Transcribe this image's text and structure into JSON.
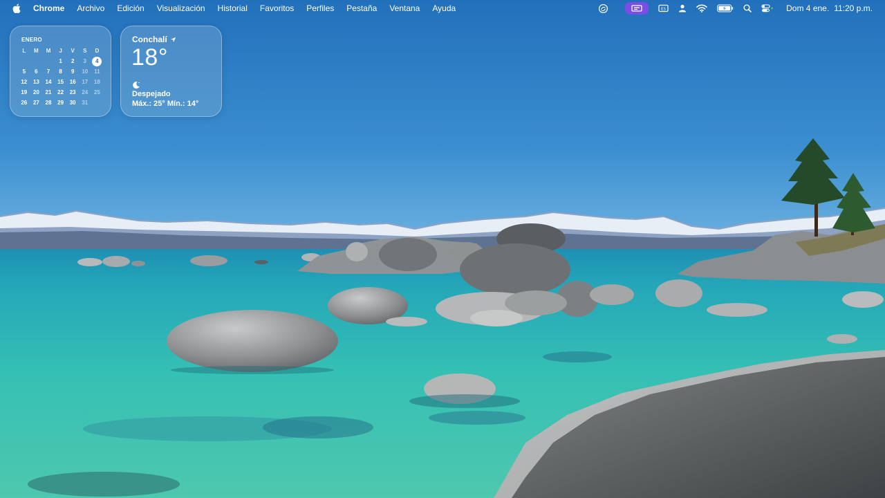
{
  "menubar": {
    "app_name": "Chrome",
    "menus": [
      "Archivo",
      "Edición",
      "Visualización",
      "Historial",
      "Favoritos",
      "Perfiles",
      "Pestaña",
      "Ventana",
      "Ayuda"
    ],
    "icons": [
      "apple-icon",
      "chatgpt-icon",
      "screen-share-icon",
      "input-menu-icon",
      "user-icon",
      "wifi-icon",
      "battery-icon",
      "search-icon",
      "control-center-icon"
    ],
    "accent_pill_color": "#7a4de6",
    "date": "Dom 4 ene.",
    "time": "11:20 p.m."
  },
  "calendar": {
    "month": "ENERO",
    "weekdays": [
      "L",
      "M",
      "M",
      "J",
      "V",
      "S",
      "D"
    ],
    "today": "4",
    "days": [
      "",
      "",
      "",
      "1",
      "2",
      "3",
      "4",
      "5",
      "6",
      "7",
      "8",
      "9",
      "10",
      "11",
      "12",
      "13",
      "14",
      "15",
      "16",
      "17",
      "18",
      "19",
      "20",
      "21",
      "22",
      "23",
      "24",
      "25",
      "26",
      "27",
      "28",
      "29",
      "30",
      "31",
      ""
    ]
  },
  "weather": {
    "location": "Conchalí",
    "temperature": "18°",
    "condition": "Despejado",
    "range": "Máx.: 25° Mín.: 14°",
    "condition_icon": "moon-icon"
  },
  "wallpaper": {
    "description_colors": {
      "sky": "#2f86c9",
      "water": "#2bb6b3",
      "rock": "#8f9090"
    }
  }
}
